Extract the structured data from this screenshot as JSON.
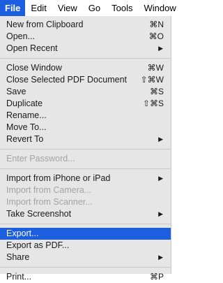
{
  "menubar": {
    "items": [
      "File",
      "Edit",
      "View",
      "Go",
      "Tools",
      "Window"
    ],
    "active": "File"
  },
  "menu": {
    "new_from_clipboard": {
      "label": "New from Clipboard",
      "shortcut": "⌘N"
    },
    "open": {
      "label": "Open...",
      "shortcut": "⌘O"
    },
    "open_recent": {
      "label": "Open Recent"
    },
    "close_window": {
      "label": "Close Window",
      "shortcut": "⌘W"
    },
    "close_selected_pdf": {
      "label": "Close Selected PDF Document",
      "shortcut": "⇧⌘W"
    },
    "save": {
      "label": "Save",
      "shortcut": "⌘S"
    },
    "duplicate": {
      "label": "Duplicate",
      "shortcut": "⇧⌘S"
    },
    "rename": {
      "label": "Rename..."
    },
    "move_to": {
      "label": "Move To..."
    },
    "revert_to": {
      "label": "Revert To"
    },
    "enter_password": {
      "label": "Enter Password..."
    },
    "import_iphone": {
      "label": "Import from iPhone or iPad"
    },
    "import_camera": {
      "label": "Import from Camera..."
    },
    "import_scanner": {
      "label": "Import from Scanner..."
    },
    "take_screenshot": {
      "label": "Take Screenshot"
    },
    "export": {
      "label": "Export..."
    },
    "export_pdf": {
      "label": "Export as PDF..."
    },
    "share": {
      "label": "Share"
    },
    "print": {
      "label": "Print...",
      "shortcut": "⌘P"
    }
  },
  "colors": {
    "highlight": "#1b5fe0",
    "menu_bg": "#e6e6e6",
    "disabled_text": "#a3a3a3"
  },
  "icons": {
    "submenu": "chevron-right-icon"
  }
}
